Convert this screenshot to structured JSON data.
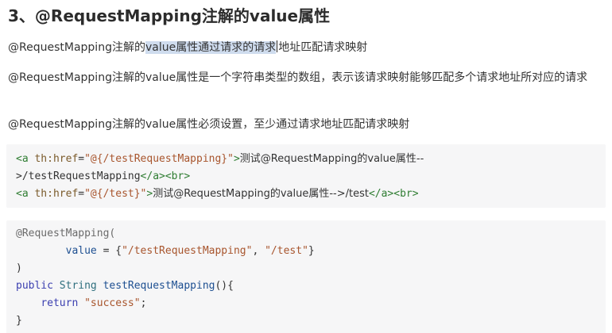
{
  "heading": "3、@RequestMapping注解的value属性",
  "paragraphs": {
    "p1": {
      "before": "@RequestMapping注解的",
      "selected": "value属性通过请求的请求",
      "after": "地址匹配请求映射"
    },
    "p2": "@RequestMapping注解的value属性是一个字符串类型的数组，表示该请求映射能够匹配多个请求地址所对应的请求",
    "p3": "@RequestMapping注解的value属性必须设置，至少通过请求地址匹配请求映射"
  },
  "code1": {
    "line1": {
      "open": "<a",
      "attr": "th:href",
      "eq": "=",
      "value": "\"@{/testRequestMapping}\"",
      "close": ">",
      "text": "测试@RequestMapping的value属性--"
    },
    "line2": {
      "text": ">/testRequestMapping",
      "end_a": "</a>",
      "br": "<br>"
    },
    "line3": {
      "open": "<a",
      "attr": "th:href",
      "eq": "=",
      "value": "\"@{/test}\"",
      "close": ">",
      "text": "测试@RequestMapping的value属性-->/test",
      "end_a": "</a>",
      "br": "<br>"
    }
  },
  "code2": {
    "line1": "@RequestMapping(",
    "line2": {
      "indent": "        ",
      "key": "value",
      "eq": " = {",
      "s1": "\"/testRequestMapping\"",
      "comma": ", ",
      "s2": "\"/test\"",
      "close": "}"
    },
    "line3": ")",
    "line4": {
      "kw": "public",
      "type": "String",
      "fn": "testRequestMapping",
      "rest": "(){"
    },
    "line5": {
      "indent": "    ",
      "kw": "return",
      "str": "\"success\"",
      "semi": ";"
    },
    "line6": "}"
  }
}
